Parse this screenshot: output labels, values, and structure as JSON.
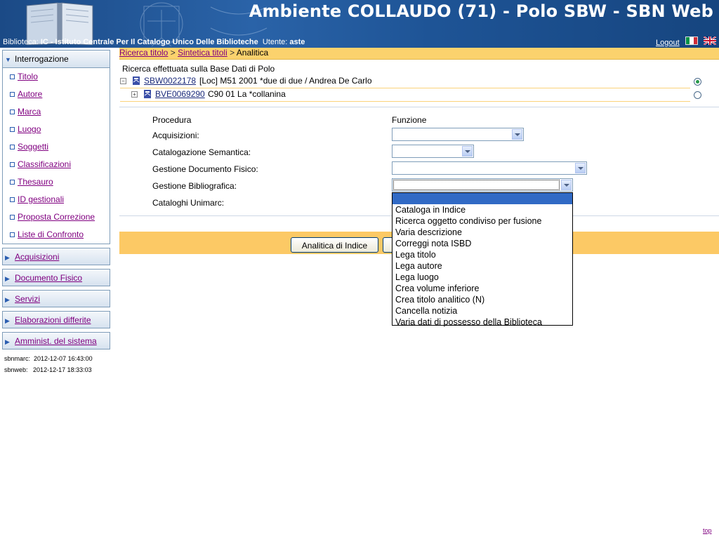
{
  "header": {
    "title": "Ambiente COLLAUDO (71) - Polo SBW - SBN Web",
    "biblioteca_label": "Biblioteca:",
    "biblioteca_value": "IC - Istituto Centrale Per Il Catalogo Unico Delle Biblioteche",
    "utente_label": "Utente:",
    "utente_value": "aste",
    "logout": "Logout"
  },
  "sidebar": {
    "interrogazione": {
      "label": "Interrogazione",
      "items": [
        "Titolo",
        "Autore",
        "Marca",
        "Luogo",
        "Soggetti",
        "Classificazioni",
        "Thesauro",
        "ID gestionali",
        "Proposta Correzione",
        "Liste di Confronto"
      ]
    },
    "sections": [
      "Acquisizioni",
      "Documento Fisico",
      "Servizi",
      "Elaborazioni differite",
      "Amminist. del sistema"
    ],
    "stamps": {
      "sbnmarc_label": "sbnmarc:",
      "sbnmarc_value": "2012-12-07 16:43:00",
      "sbnweb_label": "sbnweb:",
      "sbnweb_value": "2012-12-17 18:33:03"
    }
  },
  "breadcrumb": {
    "items": [
      "Ricerca titolo",
      "Sintetica titoli",
      "Analitica"
    ],
    "separator": ">"
  },
  "search_info": "Ricerca effettuata sulla Base Dati di Polo",
  "tree": [
    {
      "toggle": "−",
      "code": "SBW0022178",
      "description": "[Loc] M51 2001 *due di due / Andrea De Carlo",
      "selected": true
    },
    {
      "toggle": "+",
      "code": "BVE0069290",
      "description": "C90 01 La *collanina",
      "selected": false
    }
  ],
  "form": {
    "col_procedura": "Procedura",
    "col_funzione": "Funzione",
    "acquisizioni": "Acquisizioni:",
    "catalogazione_semantica": "Catalogazione Semantica:",
    "gestione_documento_fisico": "Gestione Documento Fisico:",
    "gestione_bibliografica": "Gestione Bibliografica:",
    "cataloghi_unimarc": "Cataloghi Unimarc:"
  },
  "buttons": {
    "analitica_indice": "Analitica di Indice"
  },
  "dropdown_options": [
    "",
    "Cataloga in Indice",
    "Ricerca oggetto condiviso per fusione",
    "Varia descrizione",
    "Correggi nota ISBD",
    "Lega titolo",
    "Lega autore",
    "Lega luogo",
    "Crea volume inferiore",
    "Crea titolo analitico (N)",
    "Cancella notizia",
    "Varia dati di possesso della Biblioteca"
  ],
  "footer": {
    "top_link": "top"
  },
  "colors": {
    "header_blue": "#1e5496",
    "breadcrumb_yellow": "#fbd26d",
    "button_bar": "#fcc965",
    "link_purple": "#800080",
    "selected_option": "#316ac5"
  }
}
